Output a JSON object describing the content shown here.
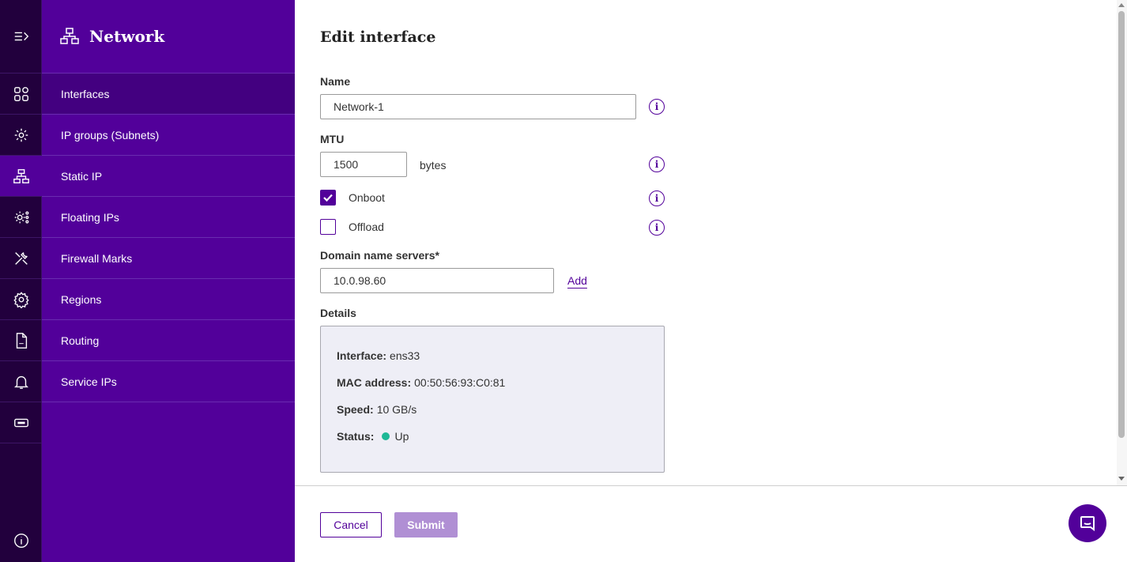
{
  "sidebar": {
    "title": "Network",
    "items": [
      {
        "label": "Interfaces",
        "active": true
      },
      {
        "label": "IP groups (Subnets)"
      },
      {
        "label": "Static IP"
      },
      {
        "label": "Floating IPs"
      },
      {
        "label": "Firewall Marks"
      },
      {
        "label": "Regions"
      },
      {
        "label": "Routing"
      },
      {
        "label": "Service IPs"
      }
    ]
  },
  "rail": {
    "icons": [
      "expand-menu-icon",
      "dashboard-grid-icon",
      "ip-settings-icon",
      "network-icon",
      "floating-ip-icon",
      "tools-icon",
      "gear-icon",
      "log-file-icon",
      "bell-icon",
      "ticket-icon",
      "info-icon"
    ]
  },
  "form": {
    "title": "Edit interface",
    "name_label": "Name",
    "name_value": "Network-1",
    "mtu_label": "MTU",
    "mtu_value": "1500",
    "mtu_unit": "bytes",
    "onboot_label": "Onboot",
    "onboot_checked": true,
    "offload_label": "Offload",
    "offload_checked": false,
    "dns_label": "Domain name servers*",
    "dns_value": "10.0.98.60",
    "add_label": "Add",
    "info_glyph": "i"
  },
  "details": {
    "label": "Details",
    "interface_label": "Interface:",
    "interface_value": "ens33",
    "mac_label": "MAC address:",
    "mac_value": "00:50:56:93:C0:81",
    "speed_label": "Speed:",
    "speed_value": "10 GB/s",
    "status_label": "Status:",
    "status_value": "Up",
    "status_color": "#1db896"
  },
  "footer": {
    "cancel_label": "Cancel",
    "submit_label": "Submit"
  },
  "colors": {
    "brand": "#52009a",
    "rail": "#22003d",
    "active": "#430080"
  }
}
